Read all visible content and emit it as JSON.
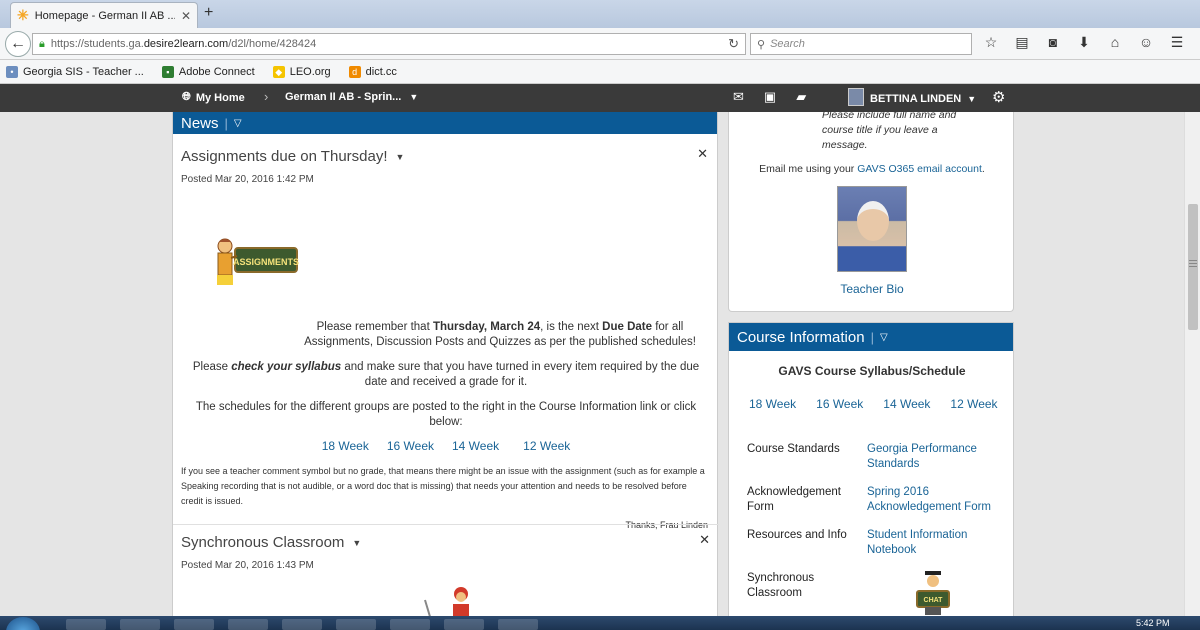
{
  "browser": {
    "tab_title": "Homepage - German II AB ...",
    "new_tab": "+",
    "url_prefix": "https://students.ga.",
    "url_domain": "desire2learn.com",
    "url_path": "/d2l/home/428424",
    "search_placeholder": "Search",
    "bookmarks": [
      {
        "label": "Georgia SIS - Teacher ...",
        "color": "#6c8ebf"
      },
      {
        "label": "Adobe Connect",
        "color": "#2e7d32"
      },
      {
        "label": "LEO.org",
        "color": "#f5c400"
      },
      {
        "label": "dict.cc",
        "color": "#f08a00"
      }
    ]
  },
  "minibar": {
    "home": "My Home",
    "course": "German II AB - Sprin...",
    "user": "BETTINA LINDEN"
  },
  "news": {
    "header": "News",
    "item1": {
      "title": "Assignments due on Thursday!",
      "posted": "Posted Mar 20, 2016 1:42 PM",
      "image_text": "ASSIGNMENTS",
      "p1_a": "Please remember that ",
      "p1_b": "Thursday, March 24",
      "p1_c": ", is the next ",
      "p1_d": "Due Date",
      "p1_e": " for all Assignments, Discussion Posts and Quizzes as per the published schedules!",
      "p2_a": "Please ",
      "p2_b": "check your syllabus",
      "p2_c": " and make sure that you have turned in every item required by the due date and received a grade for it.",
      "p3": "The schedules for the different groups are posted to the right in the Course Information link or click below:",
      "weeks": [
        "18 Week",
        "16 Week",
        "14 Week",
        "12 Week"
      ],
      "note": "If you see a teacher comment symbol but no grade, that means there might be an issue with the assignment (such as for example a Speaking recording that is not audible, or a word doc that is missing) that needs your attention and needs to be resolved before credit is issued.",
      "signature": "Thanks, Frau Linden"
    },
    "item2": {
      "title": "Synchronous Classroom",
      "posted": "Posted Mar 20, 2016 1:43 PM"
    }
  },
  "contact": {
    "message": "Please include full name and course title if you leave a message.",
    "email_a": "Email me using your ",
    "email_link": "GAVS O365 email account",
    "email_b": ".",
    "bio_link": "Teacher Bio"
  },
  "course_info": {
    "header": "Course Information",
    "title": "GAVS Course Syllabus/Schedule",
    "weeks": [
      "18 Week",
      "16 Week",
      "14 Week",
      "12 Week"
    ],
    "rows": [
      {
        "label": "Course Standards",
        "value": "Georgia Performance Standards"
      },
      {
        "label": "Acknowledgement Form",
        "value": "Spring 2016 Acknowledgement Form"
      },
      {
        "label": "Resources and Info",
        "value": "Student Information Notebook"
      },
      {
        "label": "Synchronous Classroom",
        "value": ""
      }
    ],
    "chat_text": "CHAT"
  },
  "taskbar": {
    "clock": "5:42 PM"
  }
}
